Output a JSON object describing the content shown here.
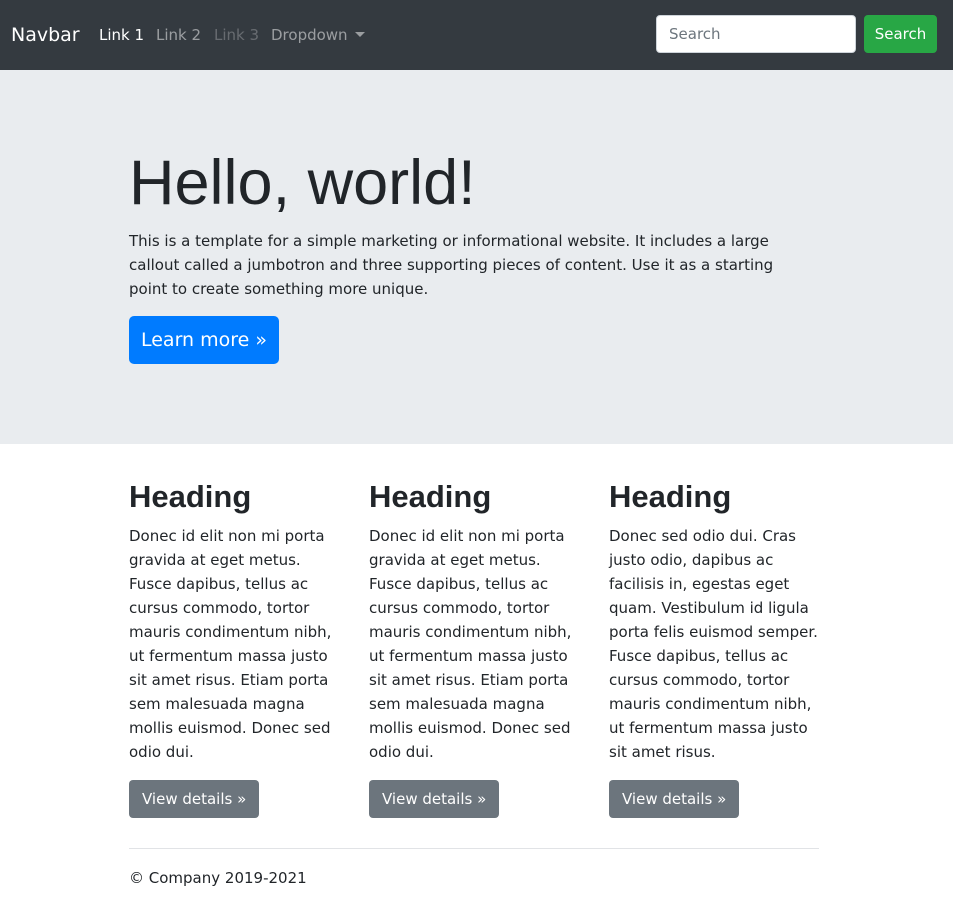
{
  "navbar": {
    "brand": "Navbar",
    "links": [
      {
        "label": "Link 1",
        "state": "active"
      },
      {
        "label": "Link 2",
        "state": "normal"
      },
      {
        "label": "Link 3",
        "state": "disabled"
      }
    ],
    "dropdown_label": "Dropdown",
    "search_placeholder": "Search",
    "search_button": "Search"
  },
  "jumbotron": {
    "title": "Hello, world!",
    "text": "This is a template for a simple marketing or informational website. It includes a large callout called a jumbotron and three supporting pieces of content. Use it as a starting point to create something more unique.",
    "button": "Learn more »"
  },
  "columns": [
    {
      "heading": "Heading",
      "text": "Donec id elit non mi porta gravida at eget metus. Fusce dapibus, tellus ac cursus commodo, tortor mauris condimentum nibh, ut fermentum massa justo sit amet risus. Etiam porta sem malesuada magna mollis euismod. Donec sed odio dui.",
      "button": "View details »"
    },
    {
      "heading": "Heading",
      "text": "Donec id elit non mi porta gravida at eget metus. Fusce dapibus, tellus ac cursus commodo, tortor mauris condimentum nibh, ut fermentum massa justo sit amet risus. Etiam porta sem malesuada magna mollis euismod. Donec sed odio dui.",
      "button": "View details »"
    },
    {
      "heading": "Heading",
      "text": "Donec sed odio dui. Cras justo odio, dapibus ac facilisis in, egestas eget quam. Vestibulum id ligula porta felis euismod semper. Fusce dapibus, tellus ac cursus commodo, tortor mauris condimentum nibh, ut fermentum massa justo sit amet risus.",
      "button": "View details »"
    }
  ],
  "footer": {
    "text": "© Company 2019-2021"
  },
  "colors": {
    "navbar_bg": "#343a40",
    "jumbotron_bg": "#e9ecef",
    "primary": "#007bff",
    "success": "#28a745",
    "secondary": "#6c757d"
  }
}
